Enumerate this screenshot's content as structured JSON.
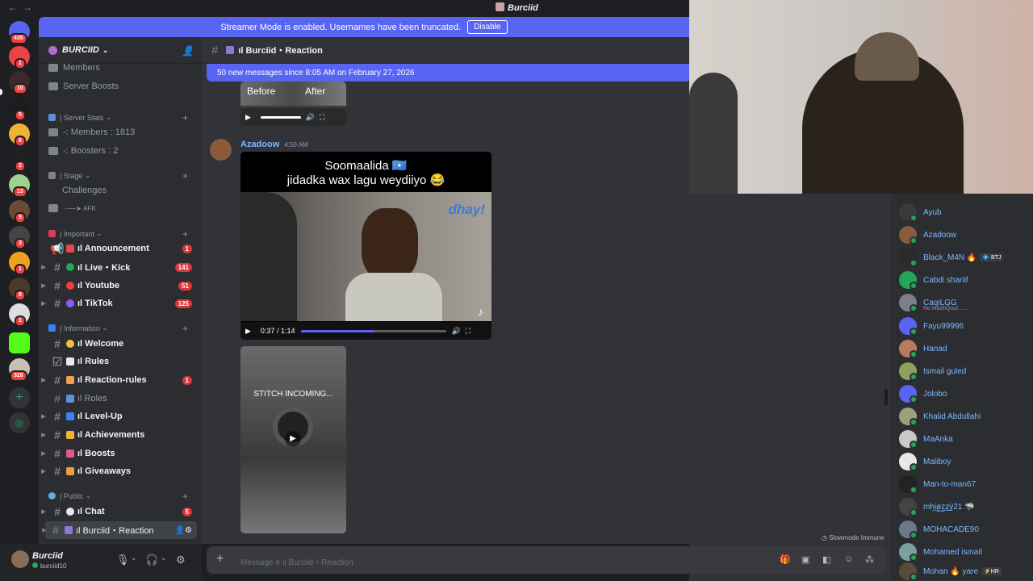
{
  "window": {
    "title": "Burciid",
    "back": "←",
    "forward": "→"
  },
  "banner": {
    "text": "Streamer Mode is enabled. Usernames have been truncated.",
    "button": "Disable"
  },
  "guilds": [
    {
      "name": "home",
      "badge": "435",
      "color": "#5865f2"
    },
    {
      "name": "discord",
      "badge": "1",
      "color": "#ed4245"
    },
    {
      "name": "server2",
      "badge": "10",
      "color": "#3a2a2a"
    },
    {
      "name": "server3",
      "badge": "5",
      "color": "#1c1c1c"
    },
    {
      "name": "server4",
      "badge": "6",
      "color": "#f0b232"
    },
    {
      "name": "server5",
      "badge": "2",
      "color": "#202020"
    },
    {
      "name": "server6",
      "badge": "13",
      "color": "#9fd18f"
    },
    {
      "name": "server7",
      "badge": "5",
      "color": "#6b4a36"
    },
    {
      "name": "server8",
      "badge": "3",
      "color": "#444"
    },
    {
      "name": "server9",
      "badge": "1",
      "color": "#f0a020"
    },
    {
      "name": "server10",
      "badge": "8",
      "color": "#4a3a2a"
    },
    {
      "name": "server11",
      "badge": "1",
      "color": "#ddd"
    },
    {
      "name": "kick",
      "badge": "",
      "color": "#53fc18"
    },
    {
      "name": "server13",
      "badge": "328",
      "color": "#c8c0b8"
    }
  ],
  "server": {
    "name": "BURCIID"
  },
  "top_items": [
    {
      "label": "Members"
    },
    {
      "label": "Server Boosts"
    }
  ],
  "categories": {
    "server_stats": "| Server Stats",
    "stage": "| Stage",
    "important": "| Important",
    "information": "| Information",
    "public": "| Public"
  },
  "stats": [
    {
      "label": "-: Members : 1813"
    },
    {
      "label": "-: Boosters : 2"
    }
  ],
  "stage": [
    {
      "label": "Challenges"
    },
    {
      "label": "AFK"
    }
  ],
  "channels": {
    "announcement": {
      "label": "ıl Announcement",
      "count": "1"
    },
    "live_kick": {
      "label": "ıl Live・Kick",
      "count": "141"
    },
    "youtube": {
      "label": "ıl Youtube",
      "count": "51"
    },
    "tiktok": {
      "label": "ıl TikTok",
      "count": "125"
    },
    "welcome": {
      "label": "ıl Welcome"
    },
    "rules": {
      "label": "ıl Rules"
    },
    "reaction_rules": {
      "label": "ıl Reaction-rules",
      "count": "1"
    },
    "roles": {
      "label": "ıl Roles"
    },
    "level_up": {
      "label": "ıl Level-Up"
    },
    "achievements": {
      "label": "ıl Achievements"
    },
    "boosts": {
      "label": "ıl Boosts"
    },
    "giveaways": {
      "label": "ıl Giveaways"
    },
    "chat": {
      "label": "ıl Chat",
      "count": "5"
    },
    "burciid_reaction": {
      "label": "ıl Burciid・Reaction"
    }
  },
  "user": {
    "name": "Burciid",
    "status": "burciid10"
  },
  "channel_header": {
    "name": "ıl Burciid・Reaction"
  },
  "new_messages": "50 new messages since 8:05 AM on February 27, 2026",
  "messages": {
    "video1": {
      "before": "Before",
      "after": "After"
    },
    "author": "Azadoow",
    "time": "4:50 AM",
    "video2": {
      "caption_line1": "Soomaalida 🇸🇴",
      "caption_line2": "jidadka wax lagu weydiiyo 😂",
      "logo": "dhay!",
      "time": "0:37 / 1:14",
      "progress": 0.5
    },
    "video3": {
      "caption": "STITCH INCOMING..."
    }
  },
  "input": {
    "placeholder": "Message # ıl Burciid・Reaction"
  },
  "slowmode": "Slowmode Immune",
  "members": [
    {
      "name": "Ayub",
      "sub": "",
      "tag": "",
      "color": "#3a3a3a"
    },
    {
      "name": "Azadoow",
      "sub": "",
      "tag": "",
      "color": "#8a5a3c"
    },
    {
      "name": "Black_M4N 🔥",
      "sub": "",
      "tag": "💠 BTJ",
      "color": "#2a2a2a"
    },
    {
      "name": "Cabdi shariif",
      "sub": "",
      "tag": "",
      "color": "#23a55a"
    },
    {
      "name": "CaqiLGG",
      "sub": "No MashQuul.......",
      "tag": "",
      "color": "#7a7f8a"
    },
    {
      "name": "Fayu99996",
      "sub": "",
      "tag": "",
      "color": "#5865f2"
    },
    {
      "name": "Hanad",
      "sub": "",
      "tag": "",
      "color": "#b87a5c"
    },
    {
      "name": "Ismail guled",
      "sub": "",
      "tag": "",
      "color": "#8fa05c"
    },
    {
      "name": "Jolobo",
      "sub": "",
      "tag": "",
      "color": "#5865f2"
    },
    {
      "name": "Khalid Abdullahi",
      "sub": "",
      "tag": "",
      "color": "#9aa07a"
    },
    {
      "name": "MaAnka",
      "sub": "",
      "tag": "",
      "color": "#c8c8c8"
    },
    {
      "name": "Maliboy",
      "sub": "",
      "tag": "",
      "color": "#e8e8e8"
    },
    {
      "name": "Man-to-man67",
      "sub": "",
      "tag": "",
      "color": "#222"
    },
    {
      "name": "mhi͟ø͟z͟z͟ÿ21 🦈",
      "sub": "",
      "tag": "",
      "color": "#444"
    },
    {
      "name": "MOHACADE90",
      "sub": "",
      "tag": "",
      "color": "#6a7a8a"
    },
    {
      "name": "Mohamed ismail",
      "sub": "",
      "tag": "",
      "color": "#7aa0a0"
    },
    {
      "name": "Mohan 🔥 yare",
      "sub": "",
      "tag": "⚡HR",
      "color": "#5a4a3a"
    }
  ]
}
